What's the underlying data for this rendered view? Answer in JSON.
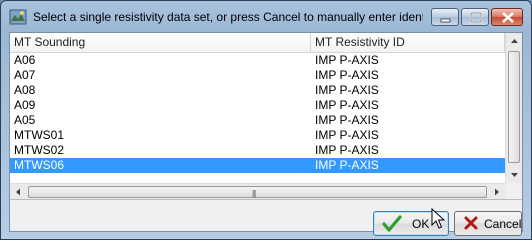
{
  "window": {
    "title": "Select a single resistivity data set, or press Cancel to manually enter identif"
  },
  "table": {
    "columns": [
      "MT Sounding",
      "MT Resistivity ID"
    ],
    "rows": [
      {
        "sounding": "A06",
        "id": "IMP P-AXIS",
        "selected": false
      },
      {
        "sounding": "A07",
        "id": "IMP P-AXIS",
        "selected": false
      },
      {
        "sounding": "A08",
        "id": "IMP P-AXIS",
        "selected": false
      },
      {
        "sounding": "A09",
        "id": "IMP P-AXIS",
        "selected": false
      },
      {
        "sounding": "A05",
        "id": "IMP P-AXIS",
        "selected": false
      },
      {
        "sounding": "MTWS01",
        "id": "IMP P-AXIS",
        "selected": false
      },
      {
        "sounding": "MTWS02",
        "id": "IMP P-AXIS",
        "selected": false
      },
      {
        "sounding": "MTWS06",
        "id": "IMP P-AXIS",
        "selected": true
      }
    ]
  },
  "buttons": {
    "ok": "OK",
    "cancel": "Cancel"
  },
  "icons": {
    "app": "app-globe-icon",
    "ok": "green-check-icon",
    "cancel": "red-x-icon"
  },
  "colors": {
    "selection": "#3399ff",
    "ok_check": "#2a9d2a",
    "cancel_x": "#b01818"
  }
}
